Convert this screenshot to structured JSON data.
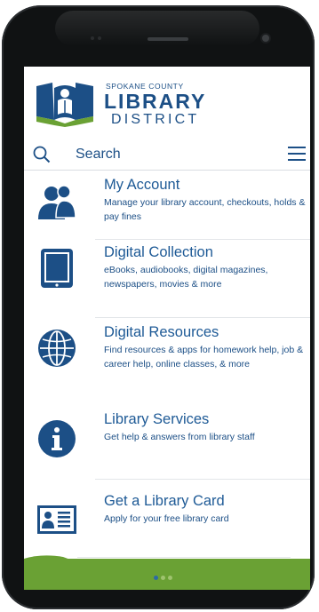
{
  "brand": {
    "line1": "SPOKANE COUNTY",
    "line2": "LIBRARY",
    "line3": "DISTRICT",
    "color": "#1c4f86"
  },
  "search": {
    "label": "Search"
  },
  "items": [
    {
      "title": "My Account",
      "description": "Manage your library account, checkouts, holds & pay fines",
      "icon": "users-icon"
    },
    {
      "title": "Digital Collection",
      "description": "eBooks, audiobooks, digital magazines, newspapers, movies & more",
      "icon": "tablet-icon"
    },
    {
      "title": "Digital Resources",
      "description": "Find resources & apps for homework help, job & career help, online classes, & more",
      "icon": "globe-icon"
    },
    {
      "title": "Library Services",
      "description": "Get help & answers from library staff",
      "icon": "info-icon"
    },
    {
      "title": "Get a Library Card",
      "description": "Apply for your free library card",
      "icon": "id-card-icon"
    }
  ],
  "pager": {
    "count": 3,
    "active": 0
  },
  "colors": {
    "accent": "#1e5a96",
    "footer": "#6aa134"
  }
}
